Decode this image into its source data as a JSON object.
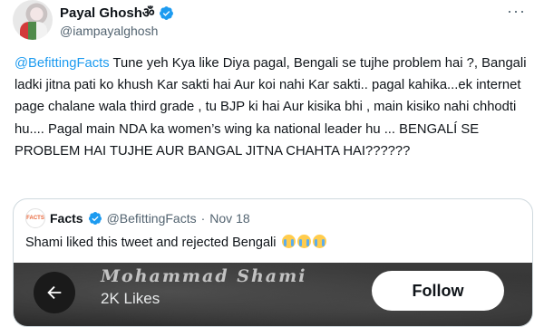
{
  "author": {
    "display_name": "Payal Ghoshॐ",
    "handle": "@iampayalghosh"
  },
  "more_label": "···",
  "tweet": {
    "mention": "@BefittingFacts",
    "body": " Tune yeh Kya like Diya pagal, Bengali se tujhe problem hai ?, Bangali ladki jitna pati ko khush Kar sakti hai Aur koi nahi Kar sakti.. pagal kahika...ek internet page chalane wala third grade , tu BJP ki hai Aur kisika bhi , main kisiko nahi chhodti hu.... Pagal main NDA ka women’s wing ka national leader hu ... BENGALÍ SE PROBLEM HAI TUJHE AUR BANGAL JITNA CHAHTA HAI??????"
  },
  "quote": {
    "avatar_text": "FACTS",
    "name": "Facts",
    "handle": "@BefittingFacts",
    "separator": "·",
    "date": "Nov 18",
    "text": "Shami liked this tweet and rejected Bengali",
    "media": {
      "overlay_title": "Mohammad Shami",
      "likes": "2K Likes",
      "follow_label": "Follow",
      "back_icon": "arrow-left-icon"
    }
  },
  "colors": {
    "accent": "#1d9bf0",
    "muted": "#536471",
    "text": "#0f1419",
    "border": "#cfd9de"
  }
}
